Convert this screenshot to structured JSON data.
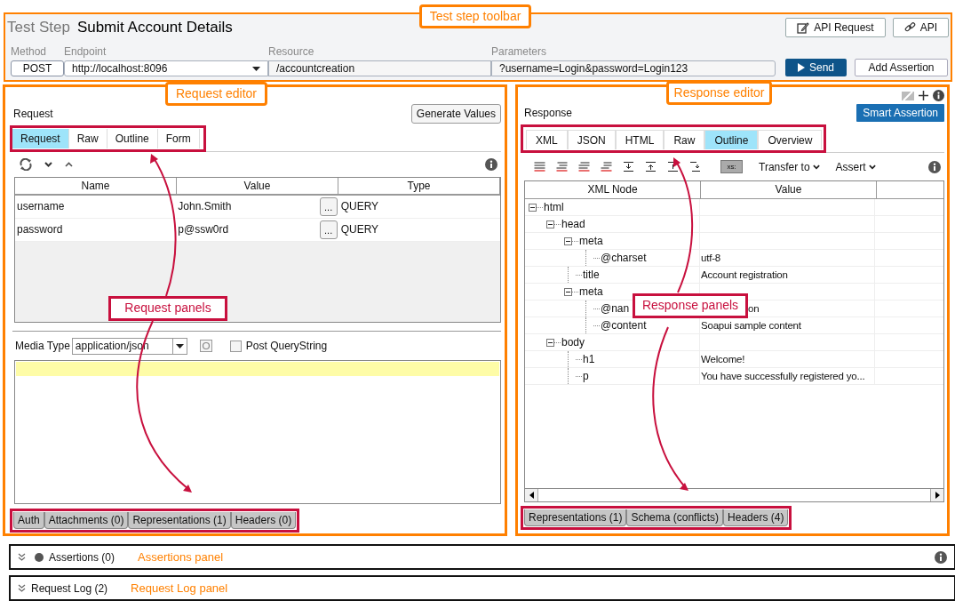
{
  "toolbar": {
    "label": "Test Step",
    "title": "Submit Account Details",
    "buttons": [
      {
        "label": "API Request"
      },
      {
        "label": "API"
      }
    ],
    "fields": [
      {
        "label": "Method",
        "value": "POST",
        "kind": "method"
      },
      {
        "label": "Endpoint",
        "value": "http://localhost:8096",
        "kind": "dropdown"
      },
      {
        "label": "Resource",
        "value": "/accountcreation",
        "kind": "text"
      },
      {
        "label": "Parameters",
        "value": "?username=Login&password=Login123",
        "kind": "text"
      }
    ],
    "send": "Send",
    "add_assertion": "Add Assertion"
  },
  "request": {
    "title": "Request",
    "generate": "Generate Values",
    "tabs": [
      {
        "label": "Request",
        "selected": true
      },
      {
        "label": "Raw",
        "selected": false
      },
      {
        "label": "Outline",
        "selected": false
      },
      {
        "label": "Form",
        "selected": false
      }
    ],
    "columns": [
      "Name",
      "Value",
      "Type"
    ],
    "rows": [
      {
        "name": "username",
        "value": "John.Smith",
        "type": "QUERY",
        "button": "..."
      },
      {
        "name": "password",
        "value": "p@ssw0rd",
        "type": "QUERY",
        "button": "..."
      }
    ],
    "media_type": {
      "label": "Media Type",
      "value": "application/json"
    },
    "post_querystring": {
      "label": "Post QueryString",
      "checked": false
    },
    "bottom_tabs": [
      "Auth",
      "Attachments (0)",
      "Representations (1)",
      "Headers (0)"
    ]
  },
  "response": {
    "title": "Response",
    "smart_assertion": "Smart Assertion",
    "tabs": [
      {
        "label": "XML",
        "selected": false
      },
      {
        "label": "JSON",
        "selected": false
      },
      {
        "label": "HTML",
        "selected": false
      },
      {
        "label": "Raw",
        "selected": false
      },
      {
        "label": "Outline",
        "selected": true
      },
      {
        "label": "Overview",
        "selected": false
      }
    ],
    "xs_button": "xs:",
    "transfer": "Transfer to",
    "assert": "Assert",
    "columns": [
      "XML Node",
      "Value"
    ],
    "tree": [
      {
        "name": "html",
        "expanded": true,
        "children": [
          {
            "name": "head",
            "expanded": true,
            "children": [
              {
                "name": "meta",
                "expanded": true,
                "children": [
                  {
                    "name": "@charset",
                    "value": "utf-8"
                  }
                ]
              },
              {
                "name": "title",
                "value": "Account registration"
              },
              {
                "name": "meta",
                "expanded": true,
                "children": [
                  {
                    "name": "@nan",
                    "value": "on",
                    "covered": true
                  },
                  {
                    "name": "@content",
                    "value": "Soapui sample content"
                  }
                ]
              }
            ]
          },
          {
            "name": "body",
            "expanded": true,
            "children": [
              {
                "name": "h1",
                "value": "Welcome!"
              },
              {
                "name": "p",
                "value": "You have successfully registered yo..."
              }
            ]
          }
        ]
      }
    ],
    "bottom_tabs": [
      "Representations (1)",
      "Schema (conflicts)",
      "Headers (4)"
    ]
  },
  "assertions": {
    "label": "Assertions (0)",
    "note": "Assertions panel"
  },
  "request_log": {
    "label": "Request Log (2)",
    "note": "Request Log panel"
  },
  "annotations": [
    {
      "text": "Test step toolbar",
      "kind": "section"
    },
    {
      "text": "Request editor",
      "kind": "section"
    },
    {
      "text": "Response editor",
      "kind": "section"
    },
    {
      "text": "Request panels",
      "kind": "panels"
    },
    {
      "text": "Response panels",
      "kind": "panels"
    }
  ]
}
